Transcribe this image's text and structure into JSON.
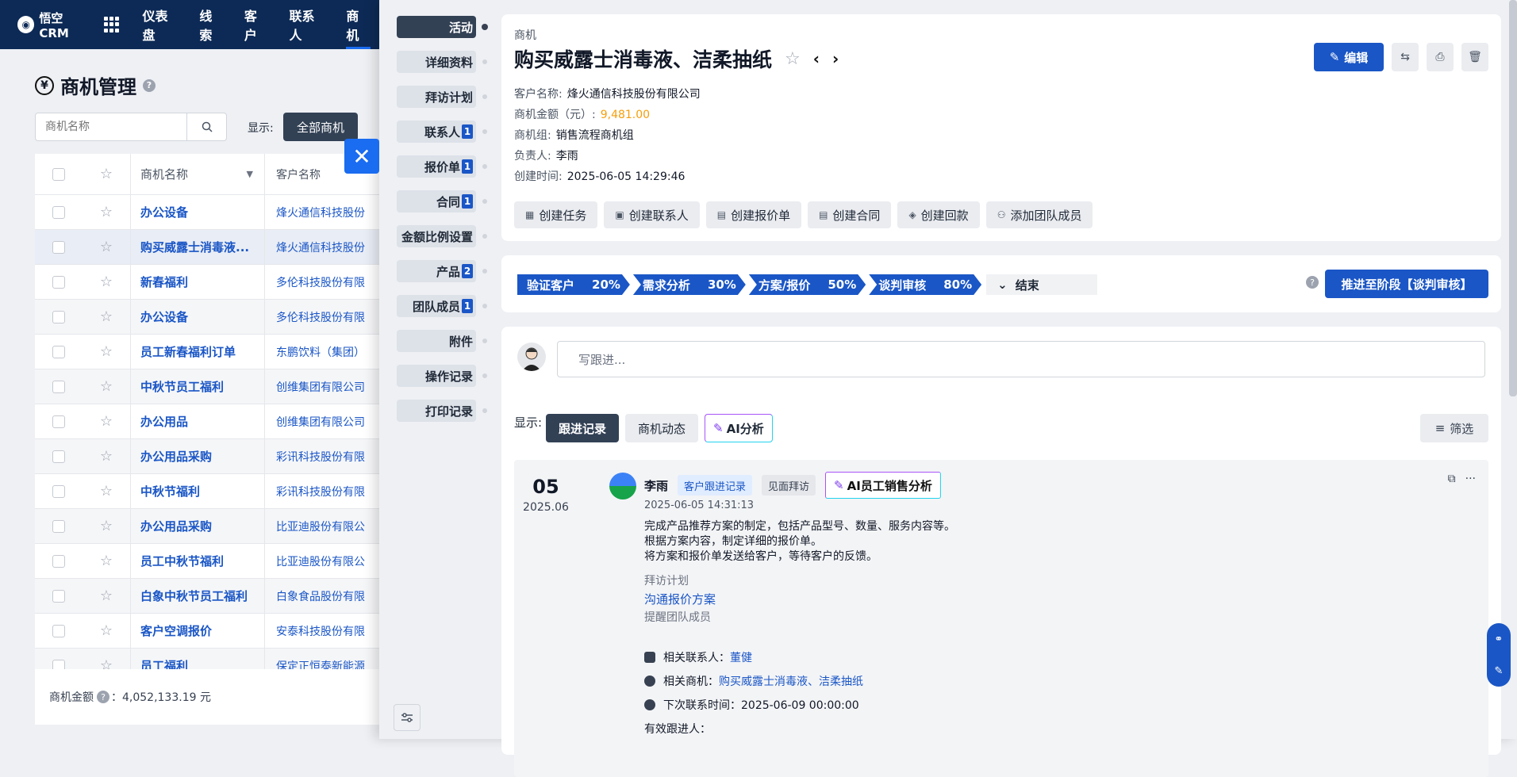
{
  "topbar": {
    "logo_text": "悟空CRM",
    "nav": [
      {
        "label": "仪表盘"
      },
      {
        "label": "线索"
      },
      {
        "label": "客户"
      },
      {
        "label": "联系人"
      },
      {
        "label": "商机"
      }
    ]
  },
  "list": {
    "page_title": "商机管理",
    "search_placeholder": "商机名称",
    "show_label": "显示:",
    "all_label": "全部商机",
    "columns": {
      "name": "商机名称",
      "customer": "客户名称"
    },
    "rows": [
      {
        "name": "办公设备",
        "customer": "烽火通信科技股份"
      },
      {
        "name": "购买威露士消毒液...",
        "customer": "烽火通信科技股份"
      },
      {
        "name": "新春福利",
        "customer": "多伦科技股份有限"
      },
      {
        "name": "办公设备",
        "customer": "多伦科技股份有限"
      },
      {
        "name": "员工新春福利订单",
        "customer": "东鹏饮料（集团）"
      },
      {
        "name": "中秋节员工福利",
        "customer": "创维集团有限公司"
      },
      {
        "name": "办公用品",
        "customer": "创维集团有限公司"
      },
      {
        "name": "办公用品采购",
        "customer": "彩讯科技股份有限"
      },
      {
        "name": "中秋节福利",
        "customer": "彩讯科技股份有限"
      },
      {
        "name": "办公用品采购",
        "customer": "比亚迪股份有限公"
      },
      {
        "name": "员工中秋节福利",
        "customer": "比亚迪股份有限公"
      },
      {
        "name": "白象中秋节员工福利",
        "customer": "白象食品股份有限"
      },
      {
        "name": "客户空调报价",
        "customer": "安泰科技股份有限"
      },
      {
        "name": "员工福利",
        "customer": "保定正恒泰新能源"
      }
    ],
    "footer_label": "商机金额",
    "footer_value": "：4,052,133.19 元"
  },
  "anchors": [
    {
      "label": "活动",
      "badge": ""
    },
    {
      "label": "详细资料",
      "badge": ""
    },
    {
      "label": "拜访计划",
      "badge": ""
    },
    {
      "label": "联系人",
      "badge": "1"
    },
    {
      "label": "报价单",
      "badge": "1"
    },
    {
      "label": "合同",
      "badge": "1"
    },
    {
      "label": "金额比例设置",
      "badge": ""
    },
    {
      "label": "产品",
      "badge": "2"
    },
    {
      "label": "团队成员",
      "badge": "1"
    },
    {
      "label": "附件",
      "badge": ""
    },
    {
      "label": "操作记录",
      "badge": ""
    },
    {
      "label": "打印记录",
      "badge": ""
    }
  ],
  "detail": {
    "crumb": "商机",
    "title": "购买威露士消毒液、洁柔抽纸",
    "edit_label": "编辑",
    "fields": [
      {
        "label": "客户名称:",
        "value": "烽火通信科技股份有限公司"
      },
      {
        "label": "商机金额（元）:",
        "value": "9,481.00"
      },
      {
        "label": "商机组:",
        "value": "销售流程商机组"
      },
      {
        "label": "负责人:",
        "value": "李雨"
      },
      {
        "label": "创建时间:",
        "value": "2025-06-05 14:29:46"
      }
    ],
    "actions": [
      {
        "label": "创建任务"
      },
      {
        "label": "创建联系人"
      },
      {
        "label": "创建报价单"
      },
      {
        "label": "创建合同"
      },
      {
        "label": "创建回款"
      },
      {
        "label": "添加团队成员"
      }
    ]
  },
  "stages": {
    "items": [
      {
        "name": "验证客户",
        "pct": "20%"
      },
      {
        "name": "需求分析",
        "pct": "30%"
      },
      {
        "name": "方案/报价",
        "pct": "50%"
      },
      {
        "name": "谈判审核",
        "pct": "80%"
      }
    ],
    "end_label": "结束",
    "advance_label": "推进至阶段【谈判审核】"
  },
  "activity": {
    "input_placeholder": "写跟进...",
    "show_label": "显示:",
    "tabs": [
      {
        "label": "跟进记录"
      },
      {
        "label": "商机动态"
      },
      {
        "label": "AI分析"
      }
    ],
    "filter_label": "筛选",
    "record": {
      "day": "05",
      "year_month": "2025.06",
      "author": "李雨",
      "tag_type": "客户跟进记录",
      "tag_method": "见面拜访",
      "ai_label": "AI员工销售分析",
      "time": "2025-06-05 14:31:13",
      "content": "完成产品推荐方案的制定，包括产品型号、数量、服务内容等。\n根据方案内容，制定详细的报价单。\n将方案和报价单发送给客户，等待客户的反馈。",
      "visit_plan_label": "拜访计划",
      "visit_plan_value": "沟通报价方案",
      "remind_label": "提醒团队成员",
      "contact_label": "相关联系人：",
      "contact_value": "董健",
      "opp_label": "相关商机：",
      "opp_value": "购买威露士消毒液、洁柔抽纸",
      "next_label": "下次联系时间：",
      "next_value": "2025-06-09 00:00:00",
      "effective_label": "有效跟进人："
    }
  }
}
